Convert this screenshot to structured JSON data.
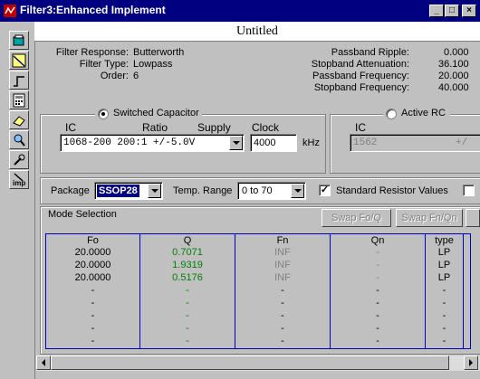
{
  "window": {
    "title": "Filter3:Enhanced Implement"
  },
  "document": {
    "title": "Untitled"
  },
  "summary_left": [
    {
      "label": "Filter Response:",
      "value": "Butterworth"
    },
    {
      "label": "Filter Type:",
      "value": "Lowpass"
    },
    {
      "label": "Order:",
      "value": "6"
    }
  ],
  "summary_right": [
    {
      "label": "Passband Ripple:",
      "value": "0.000"
    },
    {
      "label": "Stopband Attenuation:",
      "value": "36.100"
    },
    {
      "label": "Passband Frequency:",
      "value": "20.000"
    },
    {
      "label": "Stopband Frequency:",
      "value": "40.000"
    }
  ],
  "switched_cap": {
    "label": "Switched Capacitor",
    "selected": true,
    "headers": {
      "ic": "IC",
      "ratio": "Ratio",
      "supply": "Supply",
      "clock": "Clock"
    },
    "ic_value": "1068-200 200:1 +/-5.0V",
    "clock_value": "4000",
    "clock_unit": "kHz"
  },
  "active_rc": {
    "label": "Active RC",
    "selected": false,
    "ic_header": "IC",
    "ic_value": "1562",
    "ic_value_cut": "+/"
  },
  "options": {
    "package_label": "Package",
    "package_value": "SSOP28",
    "temp_label": "Temp. Range",
    "temp_value": "0 to 70",
    "std_resistor_label": "Standard Resistor Values",
    "std_resistor_checked": true,
    "std_resistor_mark": "✓"
  },
  "mode_selection": {
    "label": "Mode Selection",
    "swap_fo_q": "Swap Fo/Q",
    "swap_fn_qn": "Swap Fn/Qn"
  },
  "table": {
    "headers": {
      "fo": "Fo",
      "q": "Q",
      "fn": "Fn",
      "qn": "Qn",
      "type": "type"
    },
    "rows": [
      {
        "fo": "20.0000",
        "q": "0.7071",
        "fn": "INF",
        "qn": "-",
        "type": "LP"
      },
      {
        "fo": "20.0000",
        "q": "1.9319",
        "fn": "INF",
        "qn": "-",
        "type": "LP"
      },
      {
        "fo": "20.0000",
        "q": "0.5176",
        "fn": "INF",
        "qn": "-",
        "type": "LP"
      }
    ],
    "empty_mark": "-",
    "colors": {
      "q": "#008000",
      "fn": "#808080",
      "border": "#0000c0"
    }
  },
  "toolbar": {
    "tools": [
      "open-icon",
      "lowpass-icon",
      "step-icon",
      "calculator-icon",
      "eraser-icon",
      "zoom-icon",
      "probe-icon",
      "impedance-icon"
    ],
    "imp_text": "imp"
  },
  "title_buttons": {
    "minimize": "_",
    "maximize": "□",
    "close": "×"
  },
  "colors": {
    "titlebar": "#000080",
    "face": "#c0c0c0"
  }
}
